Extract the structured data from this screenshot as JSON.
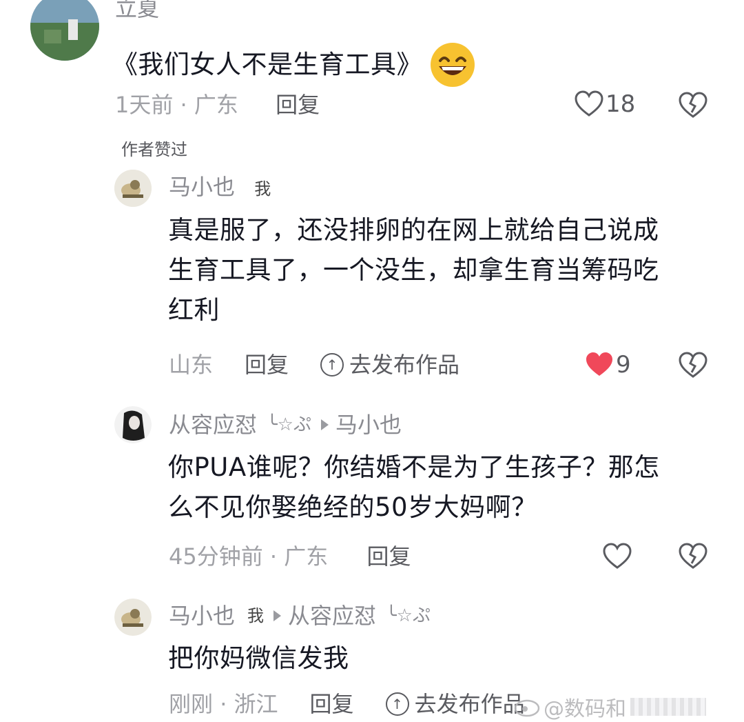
{
  "colors": {
    "liked_heart": "#f0485a",
    "meta": "#a0a1a6",
    "text": "#161823"
  },
  "comments": [
    {
      "name": "立夏",
      "text": "《我们女人不是生育工具》",
      "emoji": "grinning-face",
      "time": "1天前",
      "location": "广东",
      "reply": "回复",
      "likes": "18",
      "author_liked": "作者赞过"
    },
    {
      "name": "马小也",
      "me_tag": "我",
      "lines": [
        "真是服了，还没排卵的在网上就给自己说成",
        "生育工具了，一个没生，却拿生育当筹码吃",
        "红利"
      ],
      "location": "山东",
      "reply": "回复",
      "publish": "去发布作品",
      "likes": "9",
      "liked": true
    },
    {
      "name": "从容应怼",
      "name_suffix": "╰☆ぷ",
      "reply_to": "马小也",
      "lines": [
        "你PUA谁呢？你结婚不是为了生孩子？那怎",
        "么不见你娶绝经的50岁大妈啊？"
      ],
      "time": "45分钟前",
      "location": "广东",
      "reply": "回复"
    },
    {
      "name": "马小也",
      "me_tag": "我",
      "reply_to": "从容应怼",
      "reply_to_suffix": "╰☆ぷ",
      "text": "把你妈微信发我",
      "time": "刚刚",
      "location": "浙江",
      "reply": "回复",
      "publish": "去发布作品"
    }
  ],
  "watermark": "@数码和"
}
